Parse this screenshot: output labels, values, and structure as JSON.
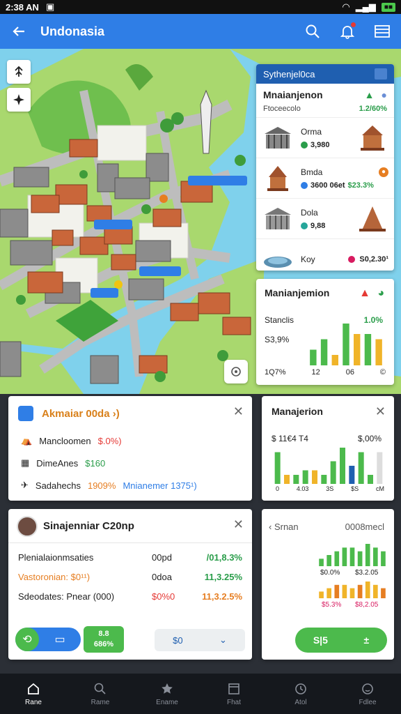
{
  "status": {
    "time": "2:38 AN"
  },
  "appbar": {
    "title": "Undonasia"
  },
  "map": {
    "labels": [
      "",
      "",
      ""
    ]
  },
  "landmarks": {
    "header": "Sythenjel0ca",
    "subtitle": "Mnaianjenon",
    "caption": "Ftoceecolo",
    "caption_pct": "1.2/60%",
    "items": [
      {
        "name": "Orma",
        "value": "3,980"
      },
      {
        "name": "Bmda",
        "value": "3600 06et",
        "extra": "$23.3%"
      },
      {
        "name": "Dola",
        "value": "9,88"
      },
      {
        "name": "Koy",
        "value": "S0,2.30¹"
      }
    ]
  },
  "stats": {
    "title": "Manianjemion",
    "s1": "Stanclis",
    "s1_pct": "1.0%",
    "s2": "S3,9%",
    "footer": [
      "1Q7%",
      "12",
      "06",
      "©"
    ],
    "chart_data": {
      "type": "bar",
      "series": [
        {
          "values": [
            3,
            5,
            2,
            8,
            3,
            6,
            4
          ]
        },
        {
          "values": [
            0,
            0,
            0,
            0,
            6,
            0,
            5
          ]
        }
      ]
    }
  },
  "info": {
    "title": "Akmaiar 00da ›)",
    "lines": [
      {
        "label": "Mancloomen",
        "value": "$.0%)"
      },
      {
        "label": "DimeAnes",
        "value": "$160"
      },
      {
        "label": "Sadahechs",
        "value": "1909%",
        "extra": "Mnianemer 1375¹)"
      }
    ]
  },
  "mgmt": {
    "title": "Manajerion",
    "left": "$ 11€4 T4",
    "right": "$,00%",
    "xticks": [
      "0",
      "4.03",
      "3S",
      "$S",
      "cM"
    ],
    "chart_data": {
      "type": "bar",
      "values": [
        7,
        2,
        2,
        3,
        3,
        2,
        5,
        8,
        4,
        7,
        2,
        7
      ]
    }
  },
  "profile": {
    "name": "Sinajenniar C20np",
    "rows": [
      {
        "a": "Plenialaionmsaties",
        "b": "00pd",
        "c": "/01,8.3%"
      },
      {
        "a": "Vastoronian: $0¹¹)",
        "b": "0doa",
        "c": "11,3.25%"
      },
      {
        "a": "Sdeodates: Pnear (000)",
        "b": "$0%0",
        "c": "11,3.2.5%"
      }
    ],
    "badge": "8.8\n686%",
    "select_value": "$0"
  },
  "sensor": {
    "back_label": "Srnan",
    "right_label": "0008mecl",
    "green_vals": [
      "$0.0%",
      "$3.2.05"
    ],
    "yellow_vals": [
      "$5.3%",
      "$8,2.05"
    ],
    "go_label": "S|5",
    "chart_data": {
      "type": "bar",
      "series": [
        {
          "name": "green",
          "values": [
            2,
            3,
            4,
            5,
            5,
            4,
            6,
            5,
            4
          ]
        },
        {
          "name": "yellow",
          "values": [
            2,
            3,
            4,
            4,
            3,
            4,
            5,
            4,
            3
          ]
        }
      ]
    }
  },
  "nav": [
    {
      "label": "Rane"
    },
    {
      "label": "Rame"
    },
    {
      "label": "Ename"
    },
    {
      "label": "Fhat"
    },
    {
      "label": "Atol"
    },
    {
      "label": "Fdlee"
    }
  ]
}
